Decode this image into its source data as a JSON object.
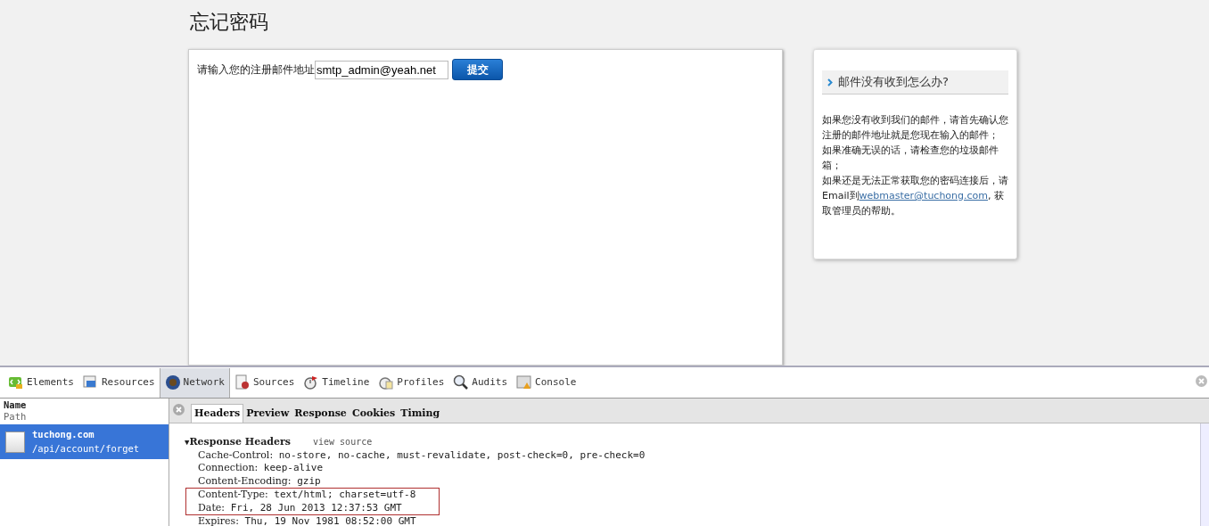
{
  "page": {
    "title": "忘记密码",
    "form": {
      "label": "请输入您的注册邮件地址",
      "email_value": "smtp_admin@yeah.net",
      "submit": "提交"
    },
    "help": {
      "heading": "邮件没有收到怎么办?",
      "lines": [
        "如果您没有收到我们的邮件，请首先确认您注册的邮件地址就是您现在输入的邮件；",
        "如果准确无误的话，请检查您的垃圾邮件箱；"
      ],
      "last_before": "如果还是无法正常获取您的密码连接后，请Email到",
      "link": "webmaster@tuchong.com",
      "last_after": ", 获取管理员的帮助。"
    }
  },
  "devtools": {
    "tabs": [
      {
        "label": "Elements",
        "kind": "elements",
        "selected": false
      },
      {
        "label": "Resources",
        "kind": "resources",
        "selected": false
      },
      {
        "label": "Network",
        "kind": "network",
        "selected": true
      },
      {
        "label": "Sources",
        "kind": "sources",
        "selected": false
      },
      {
        "label": "Timeline",
        "kind": "timeline",
        "selected": false
      },
      {
        "label": "Profiles",
        "kind": "profiles",
        "selected": false
      },
      {
        "label": "Audits",
        "kind": "audits",
        "selected": false
      },
      {
        "label": "Console",
        "kind": "console",
        "selected": false
      }
    ],
    "columns": {
      "name": "Name",
      "path": "Path"
    },
    "requests": [
      {
        "name": "tuchong.com",
        "path": "/api/account/forget",
        "selected": true
      }
    ],
    "detail_tabs": [
      {
        "label": "Headers",
        "selected": true
      },
      {
        "label": "Preview",
        "selected": false
      },
      {
        "label": "Response",
        "selected": false
      },
      {
        "label": "Cookies",
        "selected": false
      },
      {
        "label": "Timing",
        "selected": false
      }
    ],
    "section": {
      "toggle": "▼",
      "title": "Response Headers",
      "expanded": true,
      "action": "view source"
    },
    "headers": [
      {
        "key": "Cache-Control:",
        "value": "no-store, no-cache, must-revalidate, post-check=0, pre-check=0",
        "highlighted": false
      },
      {
        "key": "Connection:",
        "value": "keep-alive",
        "highlighted": false
      },
      {
        "key": "Content-Encoding:",
        "value": "gzip",
        "highlighted": false
      },
      {
        "key": "Content-Type:",
        "value": "text/html; charset=utf-8",
        "highlighted": true
      },
      {
        "key": "Date:",
        "value": "Fri, 28 Jun 2013 12:37:53 GMT",
        "highlighted": true
      },
      {
        "key": "Expires:",
        "value": "Thu, 19 Nov 1981 08:52:00 GMT",
        "highlighted": false
      }
    ]
  }
}
